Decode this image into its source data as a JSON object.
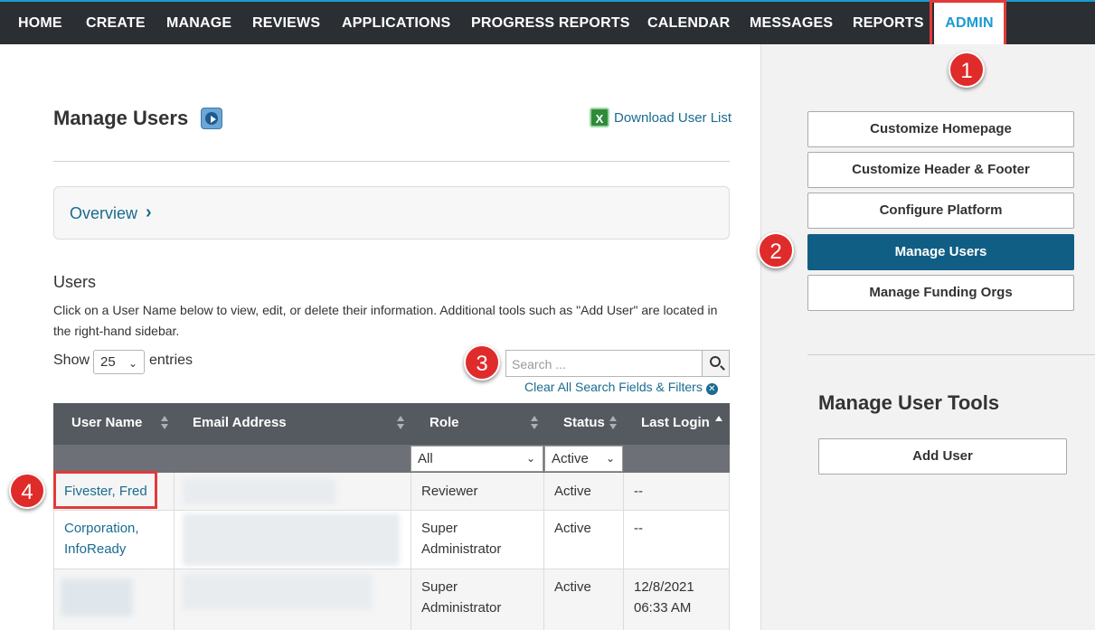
{
  "nav": {
    "items": [
      "HOME",
      "CREATE",
      "MANAGE",
      "REVIEWS",
      "APPLICATIONS",
      "PROGRESS REPORTS",
      "CALENDAR",
      "MESSAGES",
      "REPORTS",
      "ADMIN"
    ],
    "active": "ADMIN"
  },
  "callouts": [
    "1",
    "2",
    "3",
    "4"
  ],
  "page": {
    "title": "Manage Users",
    "download_label": "Download User List",
    "overview_label": "Overview",
    "users_heading": "Users",
    "users_description": "Click on a User Name below to view, edit, or delete their information. Additional tools such as \"Add User\" are located in the right-hand sidebar.",
    "show_label": "Show",
    "show_value": "25",
    "entries_label": "entries",
    "search_placeholder": "Search ...",
    "clear_label": "Clear All Search Fields & Filters"
  },
  "table": {
    "columns": [
      "User Name",
      "Email Address",
      "Role",
      "Status",
      "Last Login"
    ],
    "sorted_column": "Last Login",
    "role_filter": "All",
    "status_filter": "Active",
    "rows": [
      {
        "name": "Fivester, Fred",
        "name2": "",
        "role": "Reviewer",
        "role2": "",
        "status": "Active",
        "last_login": "--",
        "last_login2": ""
      },
      {
        "name": "Corporation,",
        "name2": "InfoReady",
        "role": "Super",
        "role2": "Administrator",
        "status": "Active",
        "last_login": "--",
        "last_login2": ""
      },
      {
        "name": "",
        "name2": "",
        "role": "Super",
        "role2": "Administrator",
        "status": "Active",
        "last_login": "12/8/2021",
        "last_login2": "06:33 AM"
      }
    ]
  },
  "sidebar": {
    "buttons": [
      "Customize Homepage",
      "Customize Header & Footer",
      "Configure Platform",
      "Manage Users",
      "Manage Funding Orgs"
    ],
    "active": "Manage Users",
    "tools_heading": "Manage User Tools",
    "add_user_label": "Add User"
  },
  "colors": {
    "nav_bg": "#2b2e33",
    "accent": "#1b9bd1",
    "link": "#1a6b8f",
    "active_button": "#115e85",
    "callout": "#e02b2b"
  }
}
